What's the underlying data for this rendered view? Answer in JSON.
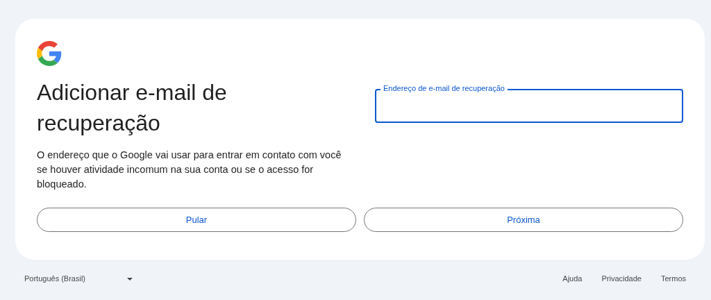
{
  "card": {
    "title": "Adicionar e-mail de recuperação",
    "description": "O endereço que o Google vai usar para entrar em contato com você se houver atividade incomum na sua conta ou se o acesso for bloqueado.",
    "field": {
      "label": "Endereço de e-mail de recuperação"
    },
    "buttons": [
      "Pular",
      "Próxima"
    ]
  },
  "footer": {
    "language": "Português (Brasil)",
    "links": [
      "Ajuda",
      "Privacidade",
      "Termos"
    ]
  }
}
